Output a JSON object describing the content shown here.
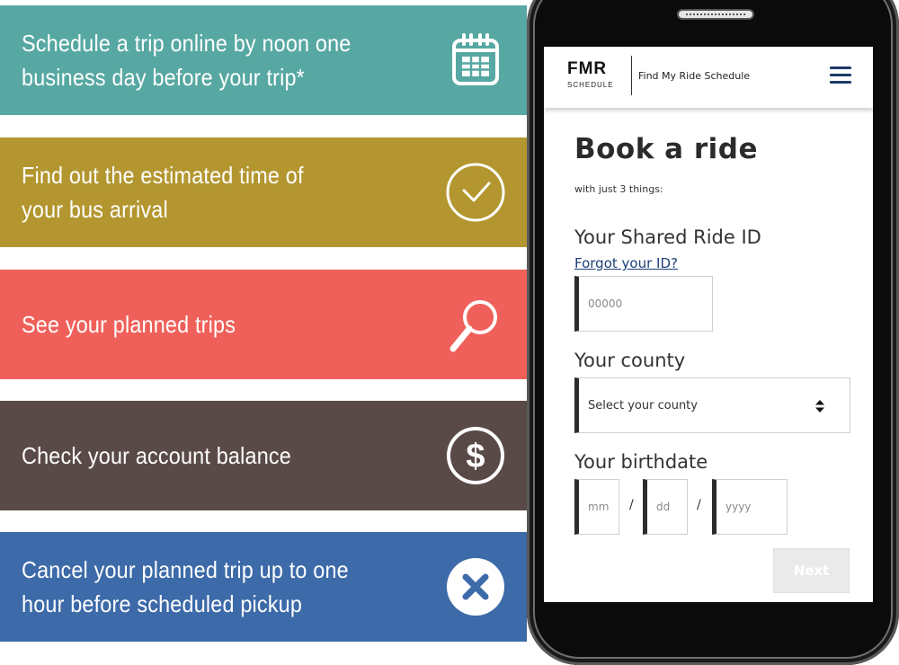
{
  "features": [
    {
      "text": "Schedule a trip online by noon one business day before your trip*",
      "icon": "calendar-icon",
      "color": "#57a8a2"
    },
    {
      "text": "Find out the estimated time of your bus arrival",
      "icon": "clock-icon",
      "color": "#b3962f"
    },
    {
      "text": "See your planned trips",
      "icon": "magnifier-icon",
      "color": "#f0605a"
    },
    {
      "text": "Check your account balance",
      "icon": "dollar-icon",
      "color": "#5a4a47"
    },
    {
      "text": "Cancel your planned trip up to one hour before scheduled pickup",
      "icon": "close-icon",
      "color": "#3d6aa8"
    }
  ],
  "app": {
    "logo_main": "FMR",
    "logo_sub": "SCHEDULE",
    "header_title": "Find My Ride Schedule",
    "accent": "#1d3b66"
  },
  "form": {
    "title": "Book a ride",
    "subtitle": "with just 3 things:",
    "id_label": "Your Shared Ride ID",
    "forgot_link": "Forgot your ID?",
    "id_placeholder": "00000",
    "county_label": "Your county",
    "county_selected": "Select your county",
    "birthdate_label": "Your birthdate",
    "mm_placeholder": "mm",
    "dd_placeholder": "dd",
    "yyyy_placeholder": "yyyy",
    "separator": "/",
    "next_label": "Next"
  }
}
